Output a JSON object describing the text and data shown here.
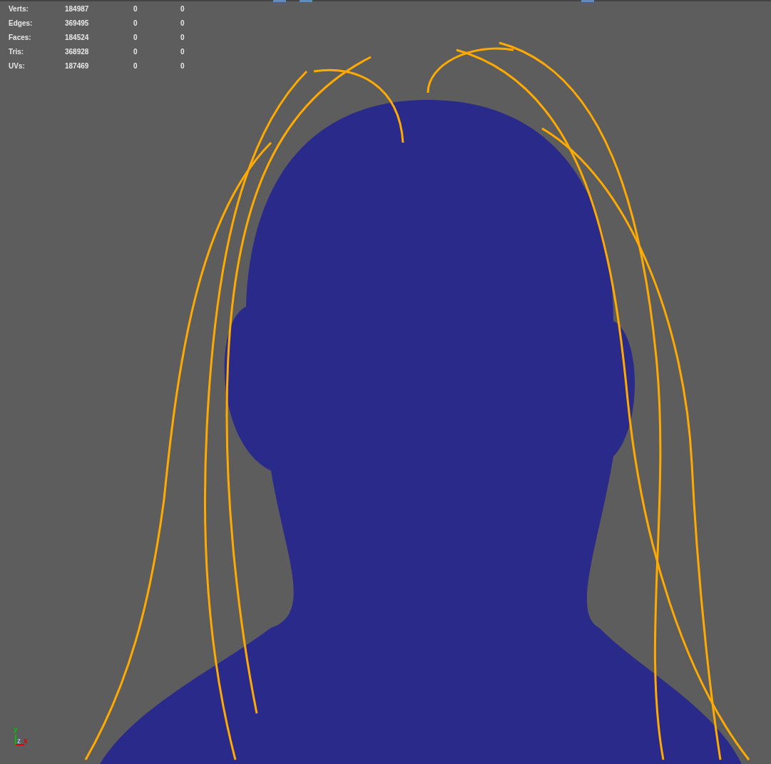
{
  "heads_up_display": {
    "rows": [
      {
        "label": "Verts:",
        "total": "184987",
        "column_3": "0",
        "column_4": "0"
      },
      {
        "label": "Edges:",
        "total": "369495",
        "column_3": "0",
        "column_4": "0"
      },
      {
        "label": "Faces:",
        "total": "184524",
        "column_3": "0",
        "column_4": "0"
      },
      {
        "label": "Tris:",
        "total": "368928",
        "column_3": "0",
        "column_4": "0"
      },
      {
        "label": "UVs:",
        "total": "187469",
        "column_3": "0",
        "column_4": "0"
      }
    ]
  },
  "axis_gizmo": {
    "y": "y",
    "z": "z",
    "x": "x"
  }
}
